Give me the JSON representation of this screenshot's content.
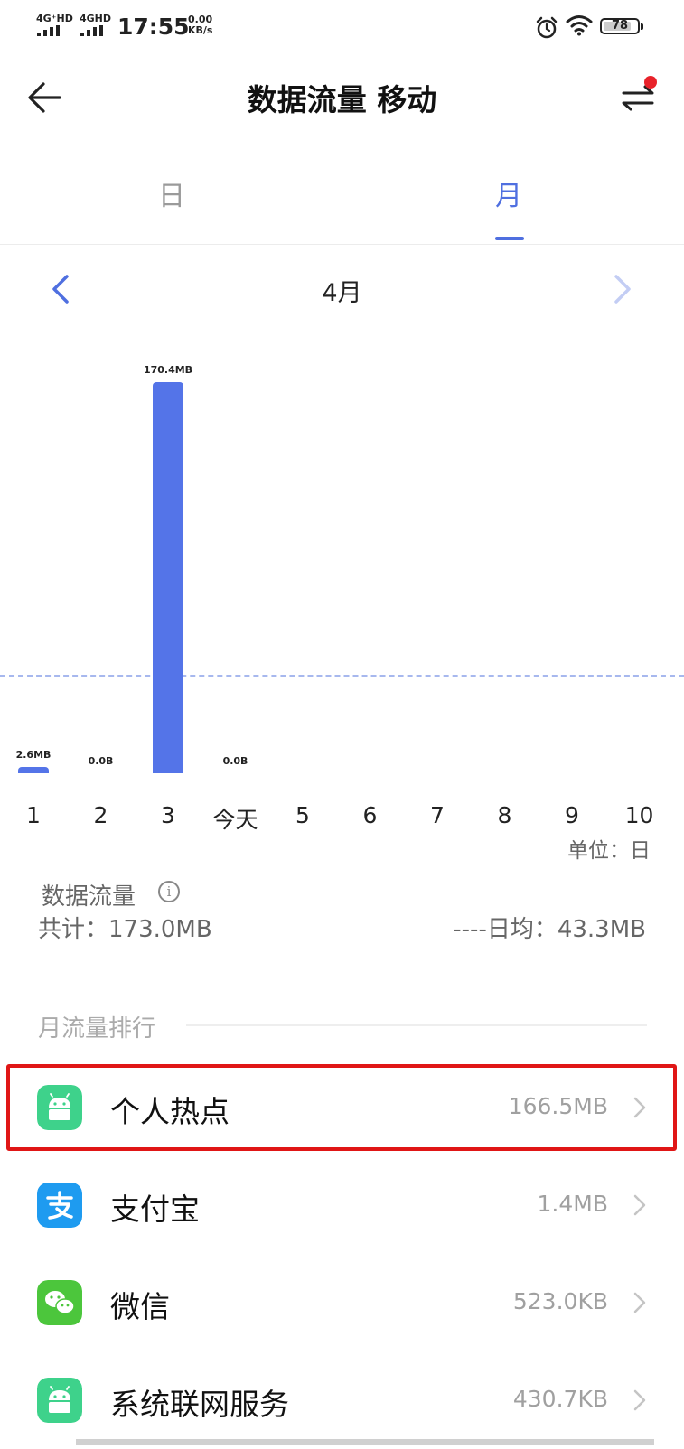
{
  "status_bar": {
    "network1": "4G⁺HD",
    "network2": "4GHD",
    "time": "17:55",
    "speed_value": "0.00",
    "speed_unit": "KB/s",
    "battery": "78",
    "icons": [
      "signal-icon",
      "signal-icon",
      "alarm-icon",
      "wifi-icon",
      "battery-icon"
    ]
  },
  "header": {
    "title": "数据流量 移动",
    "back_icon": "arrow-left-icon",
    "switch_icon": "swap-arrows-icon",
    "notification_color": "#e8222a"
  },
  "tabs": [
    {
      "label": "日",
      "active": false
    },
    {
      "label": "月",
      "active": true
    }
  ],
  "month_nav": {
    "label": "4月",
    "prev_icon": "chevron-left-icon",
    "next_icon": "chevron-right-icon"
  },
  "chart_data": {
    "type": "bar",
    "categories": [
      "1",
      "2",
      "3",
      "今天",
      "5",
      "6",
      "7",
      "8",
      "9",
      "10"
    ],
    "values_mb": [
      2.6,
      0.0,
      170.4,
      0.0,
      null,
      null,
      null,
      null,
      null,
      null
    ],
    "data_labels": [
      "2.6MB",
      "0.0B",
      "170.4MB",
      "0.0B",
      "",
      "",
      "",
      "",
      "",
      ""
    ],
    "average_line_mb": 43.3,
    "ylim": [
      0,
      170.4
    ],
    "unit_label": "单位：日",
    "bar_color": "#5474e8"
  },
  "summary": {
    "title": "数据流量",
    "total": "共计：173.0MB",
    "average": "----日均：43.3MB"
  },
  "ranking": {
    "title": "月流量排行",
    "apps": [
      {
        "name": "个人热点",
        "usage": "166.5MB",
        "icon": "android-icon",
        "color": "#3ed28b",
        "highlighted": true
      },
      {
        "name": "支付宝",
        "usage": "1.4MB",
        "icon": "alipay-icon",
        "color": "#1e9bf0",
        "highlighted": false
      },
      {
        "name": "微信",
        "usage": "523.0KB",
        "icon": "wechat-icon",
        "color": "#4cc63c",
        "highlighted": false
      },
      {
        "name": "系统联网服务",
        "usage": "430.7KB",
        "icon": "android-icon",
        "color": "#3ed28b",
        "highlighted": false
      }
    ]
  },
  "colors": {
    "accent": "#4f6fe0",
    "highlight_border": "#e01616"
  }
}
